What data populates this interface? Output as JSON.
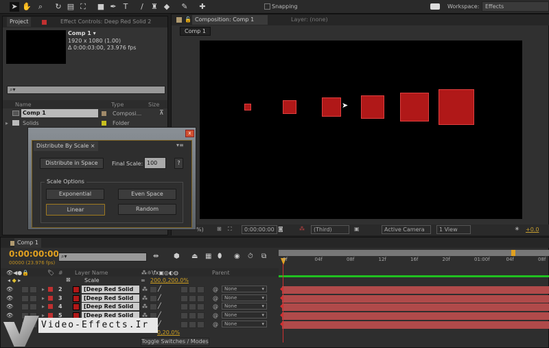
{
  "toolbar": {
    "snapping_label": "Snapping",
    "workspace_label": "Workspace:",
    "workspace_value": "Effects"
  },
  "project": {
    "tab": "Project",
    "effect_controls_tab": "Effect Controls: Deep Red Solid 2",
    "comp_name": "Comp 1 ▾",
    "comp_size": "1920 x 1080 (1.00)",
    "comp_duration": "Δ 0:00:03:00, 23.976 fps",
    "search_placeholder": "⌕▾",
    "columns": {
      "name": "Name",
      "type": "Type",
      "size": "Size"
    },
    "items": [
      {
        "name": "Comp 1",
        "type": "Composi...",
        "color": "#a08a6a"
      },
      {
        "name": "Solids",
        "type": "Folder",
        "color": "#c8c020"
      }
    ]
  },
  "composition": {
    "tab": "Composition: Comp 1",
    "layer_tab": "Layer: (none)",
    "breadcrumb": "Comp 1",
    "viewer": {
      "zoom": "%)",
      "timecode": "0:00:00:00",
      "resolution": "(Third)",
      "camera": "Active Camera",
      "views": "1 View",
      "exposure": "+0.0"
    }
  },
  "dialog": {
    "tab": "Distribute By Scale",
    "distribute_button": "Distribute in Space",
    "final_scale_label": "Final Scale:",
    "final_scale_value": "100",
    "help_button": "?",
    "group_label": "Scale Options",
    "options": [
      "Exponential",
      "Even Space",
      "Linear",
      "Random"
    ],
    "selected": "Linear"
  },
  "timeline": {
    "tab": "Comp 1",
    "timecode": "0:00:00:00",
    "frames": "00000 (23.976 fps)",
    "columns": {
      "layer_name": "Layer Name",
      "parent": "Parent",
      "number": "#"
    },
    "scale_label": "Scale",
    "scale_value": "200.0,200.0%",
    "scale_value_2": "0,20.0%",
    "layers": [
      {
        "num": "2",
        "name": "[Deep Red Solid 2]",
        "parent": "None"
      },
      {
        "num": "3",
        "name": "[Deep Red Solid 2]",
        "parent": "None"
      },
      {
        "num": "4",
        "name": "[Deep Red Solid 2]",
        "parent": "None"
      },
      {
        "num": "5",
        "name": "[Deep Red Solid 2]",
        "parent": "None"
      },
      {
        "num": "",
        "name": "",
        "parent": "None"
      }
    ],
    "ruler": [
      "0f",
      "04f",
      "08f",
      "12f",
      "16f",
      "20f",
      "01:00f",
      "04f",
      "08f"
    ],
    "toggle_label": "Toggle Switches / Modes"
  },
  "watermark": "Video-Effects.Ir",
  "colors": {
    "accent": "#e0a020",
    "layer": "#b01818"
  }
}
